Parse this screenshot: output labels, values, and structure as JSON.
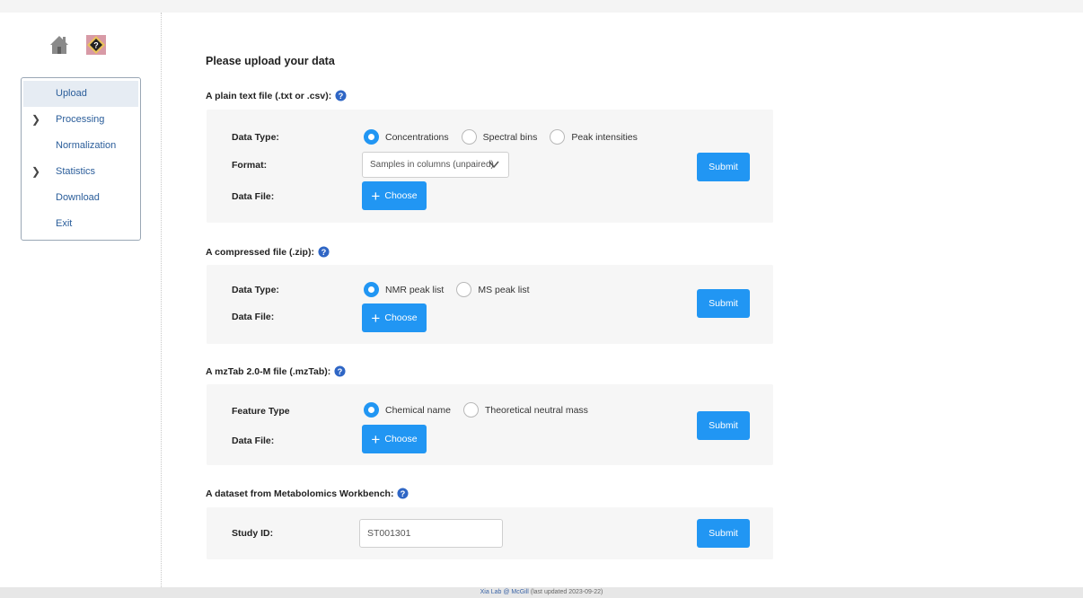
{
  "sidebar": {
    "icons": [
      "home-icon",
      "help-icon"
    ],
    "items": [
      {
        "label": "Upload",
        "expandable": false,
        "active": true
      },
      {
        "label": "Processing",
        "expandable": true,
        "active": false
      },
      {
        "label": "Normalization",
        "expandable": false,
        "active": false
      },
      {
        "label": "Statistics",
        "expandable": true,
        "active": false
      },
      {
        "label": "Download",
        "expandable": false,
        "active": false
      },
      {
        "label": "Exit",
        "expandable": false,
        "active": false
      }
    ]
  },
  "main": {
    "title": "Please upload your data",
    "sections": {
      "plain": {
        "title": "A plain text file (.txt or .csv):",
        "data_type_label": "Data Type:",
        "options": [
          "Concentrations",
          "Spectral bins",
          "Peak intensities"
        ],
        "selected": 0,
        "format_label": "Format:",
        "format_value": "Samples in columns (unpaired)",
        "data_file_label": "Data File:",
        "choose_label": "Choose",
        "submit_label": "Submit"
      },
      "zip": {
        "title": "A compressed file (.zip):",
        "data_type_label": "Data Type:",
        "options": [
          "NMR peak list",
          "MS peak list"
        ],
        "selected": 0,
        "data_file_label": "Data File:",
        "choose_label": "Choose",
        "submit_label": "Submit"
      },
      "mztab": {
        "title": "A mzTab 2.0-M file (.mzTab):",
        "feature_type_label": "Feature Type",
        "options": [
          "Chemical name",
          "Theoretical neutral mass"
        ],
        "selected": 0,
        "data_file_label": "Data File:",
        "choose_label": "Choose",
        "submit_label": "Submit"
      },
      "workbench": {
        "title": "A dataset from Metabolomics Workbench:",
        "study_id_label": "Study ID:",
        "study_id_value": "ST001301",
        "submit_label": "Submit"
      }
    }
  },
  "footer": {
    "link_text": "Xia Lab @ McGill",
    "updated_text": "(last updated 2023-09-22)"
  },
  "colors": {
    "accent": "#2196f3",
    "panel_bg": "#f6f6f6",
    "menu_text": "#2a5d9a"
  }
}
